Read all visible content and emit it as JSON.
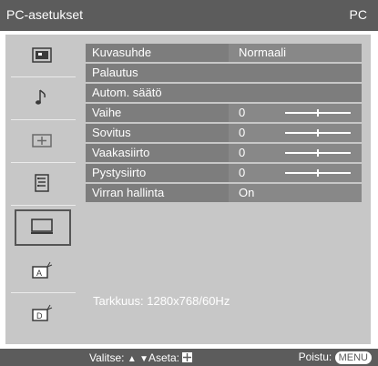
{
  "title": {
    "left": "PC-asetukset",
    "right": "PC"
  },
  "sidebar": {
    "items": [
      {
        "icon": "picture-icon"
      },
      {
        "icon": "sound-icon"
      },
      {
        "icon": "screen-icon"
      },
      {
        "icon": "features-icon"
      },
      {
        "icon": "pc-monitor-icon",
        "active": true
      },
      {
        "icon": "analog-tuning-icon"
      },
      {
        "icon": "digital-tuning-icon"
      }
    ]
  },
  "menu": {
    "rows": [
      {
        "label": "Kuvasuhde",
        "value": "Normaali"
      },
      {
        "label": "Palautus"
      },
      {
        "label": "Autom. säätö"
      },
      {
        "label": "Vaihe",
        "value": "0",
        "slider": 0.5
      },
      {
        "label": "Sovitus",
        "value": "0",
        "slider": 0.5
      },
      {
        "label": "Vaakasiirto",
        "value": "0",
        "slider": 0.5
      },
      {
        "label": "Pystysiirto",
        "value": "0",
        "slider": 0.5
      },
      {
        "label": "Virran hallinta",
        "value": "On"
      }
    ]
  },
  "info": "Tarkkuus: 1280x768/60Hz",
  "footer": {
    "select_label": "Valitse:",
    "set_label": "Aseta:",
    "exit_label": "Poistu:",
    "exit_key": "MENU"
  },
  "colors": {
    "bar": "#5c5c5c",
    "panel": "#c7c7c7",
    "row": "#7d7d7d"
  }
}
